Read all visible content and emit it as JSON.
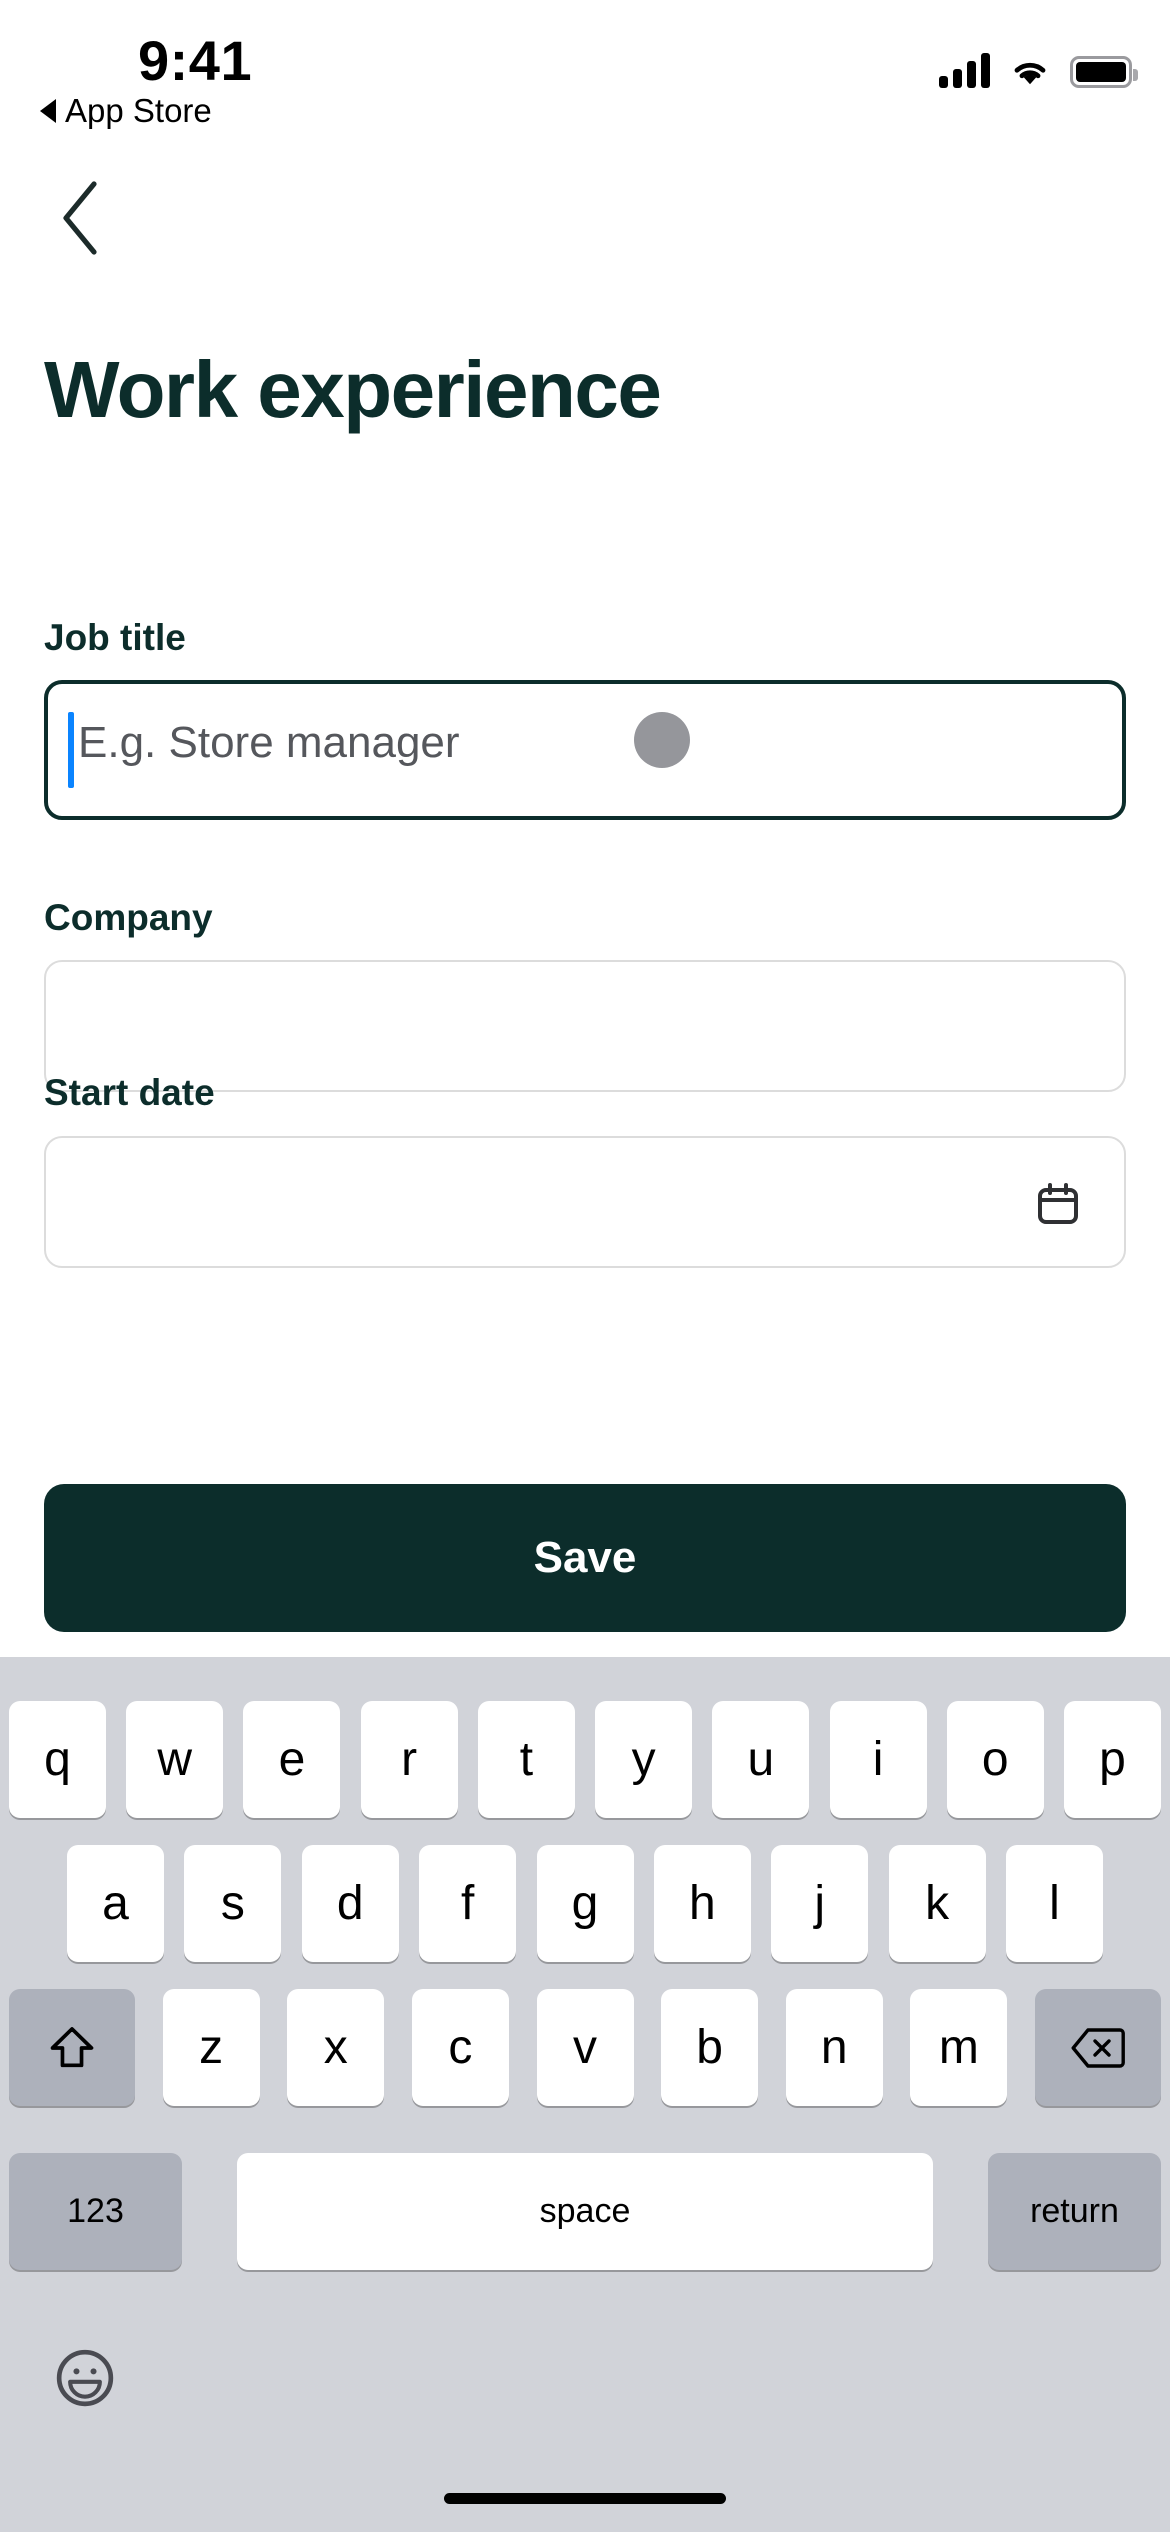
{
  "status_bar": {
    "time": "9:41",
    "back_app_label": "App Store",
    "signal_icon": "cellular-bars-icon",
    "wifi_icon": "wifi-icon",
    "battery_icon": "battery-full-icon"
  },
  "nav": {
    "back_icon": "chevron-left-icon"
  },
  "page": {
    "title": "Work experience"
  },
  "form": {
    "job_title": {
      "label": "Job title",
      "placeholder": "E.g. Store manager",
      "value": "",
      "focused": true
    },
    "company": {
      "label": "Company",
      "placeholder": "",
      "value": ""
    },
    "start_date": {
      "label": "Start date",
      "placeholder": "",
      "value": "",
      "icon": "calendar-icon"
    },
    "save_label": "Save"
  },
  "keyboard": {
    "row1": [
      "q",
      "w",
      "e",
      "r",
      "t",
      "y",
      "u",
      "i",
      "o",
      "p"
    ],
    "row2": [
      "a",
      "s",
      "d",
      "f",
      "g",
      "h",
      "j",
      "k",
      "l"
    ],
    "row3": [
      "z",
      "x",
      "c",
      "v",
      "b",
      "n",
      "m"
    ],
    "shift_icon": "shift-arrow-icon",
    "delete_icon": "backspace-icon",
    "numbers_label": "123",
    "space_label": "space",
    "return_label": "return",
    "emoji_icon": "emoji-smiley-icon"
  },
  "colors": {
    "brand_dark": "#0c2d2b",
    "caret_blue": "#0a84ff",
    "placeholder_grey": "#55575c",
    "touch_dot_grey": "#95969b",
    "keyboard_bg": "#d1d3d9",
    "key_dark": "#adb1bb",
    "field_border": "#dcdcdc"
  }
}
